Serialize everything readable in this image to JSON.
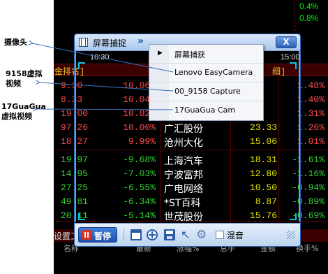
{
  "annotations": {
    "camera_label": "摄像头",
    "capture_9158_label": "9158虚拟视频",
    "guagua_label": "17GuaGua虚拟视频"
  },
  "stock_app": {
    "top_pcts": [
      "0.4%",
      "0.8%"
    ],
    "header_left": "金排名]",
    "header_right": "细]",
    "rows": [
      {
        "price": "9.30",
        "pct": "10.06%",
        "name": "",
        "val": "",
        "chg": "1.48%",
        "color": "red"
      },
      {
        "price": "8.33",
        "pct": "10.04%",
        "name": "",
        "val": "",
        "chg": "1.40%",
        "color": "red"
      },
      {
        "price": "19.00",
        "pct": "10.02%",
        "name": "",
        "val": "",
        "chg": "1.31%",
        "color": "red"
      },
      {
        "price": "97.26",
        "pct": "10.00%",
        "name": "广汇股份",
        "val": "23.33",
        "chg": "1.26%",
        "color": "red"
      },
      {
        "price": "18.27",
        "pct": "9.99%",
        "name": "沧州大化",
        "val": "15.06",
        "chg": "1.01%",
        "color": "red"
      },
      {
        "price": "19.97",
        "pct": "-9.68%",
        "name": "上海汽车",
        "val": "18.31",
        "chg": "-1.61%",
        "color": "green"
      },
      {
        "price": "14.95",
        "pct": "-7.03%",
        "name": "宁波富邦",
        "val": "12.80",
        "chg": "-1.16%",
        "color": "green"
      },
      {
        "price": "27.25",
        "pct": "-6.55%",
        "name": "广电网络",
        "val": "10.50",
        "chg": "-0.94%",
        "color": "green"
      },
      {
        "price": "49.81",
        "pct": "-6.34%",
        "name": "*ST百科",
        "val": "8.87",
        "chg": "-0.89%",
        "color": "green"
      },
      {
        "price": "20.11",
        "pct": "-5.14%",
        "name": "世茂股份",
        "val": "15.76",
        "chg": "-0.69%",
        "color": "green"
      }
    ],
    "bottom_bar_label": "设置工",
    "footer_columns": [
      "名称",
      "最新",
      "涨幅%",
      "总手",
      "金额",
      "换手%"
    ]
  },
  "capture_window": {
    "title": "屏幕捕捉",
    "expand_glyph": "»",
    "close_glyph": "X",
    "time_left": "10:30",
    "time_right": "15:00",
    "pause_label": "暂停",
    "mute_label": "混音",
    "mute_checked": false
  },
  "capture_menu": {
    "items": [
      {
        "label": "屏幕捕获",
        "active": true
      },
      {
        "label": "Lenovo EasyCamera",
        "active": false
      },
      {
        "label": "00_9158 Capture",
        "active": false
      },
      {
        "label": "17GuaGua Cam",
        "active": false
      }
    ]
  },
  "colors": {
    "up": "#ff4a4a",
    "down": "#31d631",
    "accent": "#2a66b8",
    "selection_corner": "#00c8e0"
  }
}
